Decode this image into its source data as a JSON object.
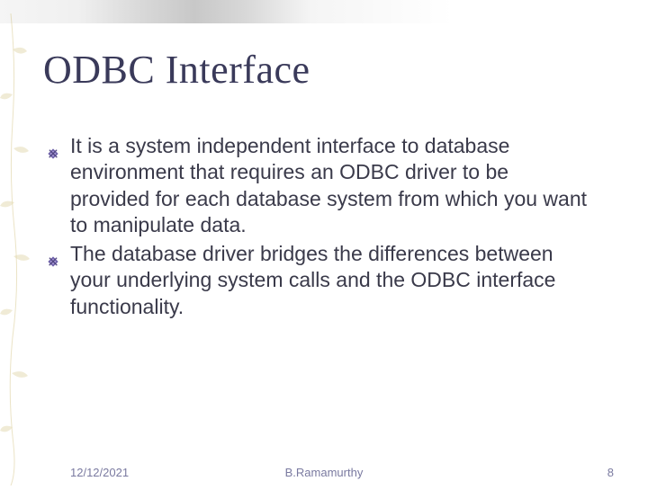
{
  "slide": {
    "title": "ODBC Interface",
    "bullets": [
      "It is a system independent interface to database environment that requires an ODBC driver to be provided for each database system from which you want to manipulate data.",
      "The database driver bridges the differences between your underlying system calls and the ODBC interface functionality."
    ]
  },
  "footer": {
    "date": "12/12/2021",
    "author": "B.Ramamurthy",
    "page": "8"
  },
  "colors": {
    "title": "#3a3a5a",
    "body": "#3a3a4a",
    "footer": "#7a7aa0",
    "accent": "#d4c060"
  }
}
